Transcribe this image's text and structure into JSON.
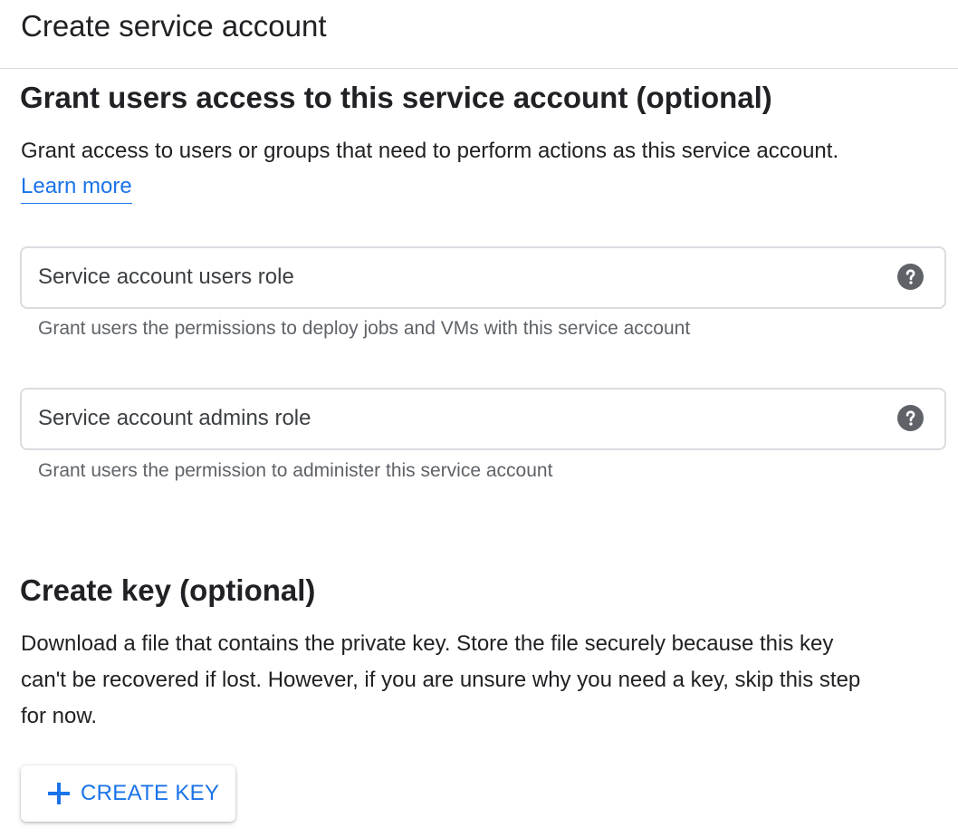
{
  "header": {
    "title": "Create service account"
  },
  "grant_section": {
    "title": "Grant users access to this service account (optional)",
    "description": "Grant access to users or groups that need to perform actions as this service account.",
    "learn_more": "Learn more",
    "fields": [
      {
        "label": "Service account users role",
        "helper": "Grant users the permissions to deploy jobs and VMs with this service account",
        "icon": "help-icon"
      },
      {
        "label": "Service account admins role",
        "helper": "Grant users the permission to administer this service account",
        "icon": "help-icon"
      }
    ]
  },
  "key_section": {
    "title": "Create key (optional)",
    "description_lines": [
      "Download a file that contains the private key. Store the file securely because this key",
      "can't be recovered if lost. However, if you are unsure why you need a key, skip this step",
      "for now."
    ],
    "button": {
      "icon": "plus-icon",
      "label": "CREATE KEY"
    }
  },
  "colors": {
    "accent": "#1a73e8",
    "text": "#202124",
    "helper_text": "#5f6368",
    "border": "#dadce0"
  }
}
